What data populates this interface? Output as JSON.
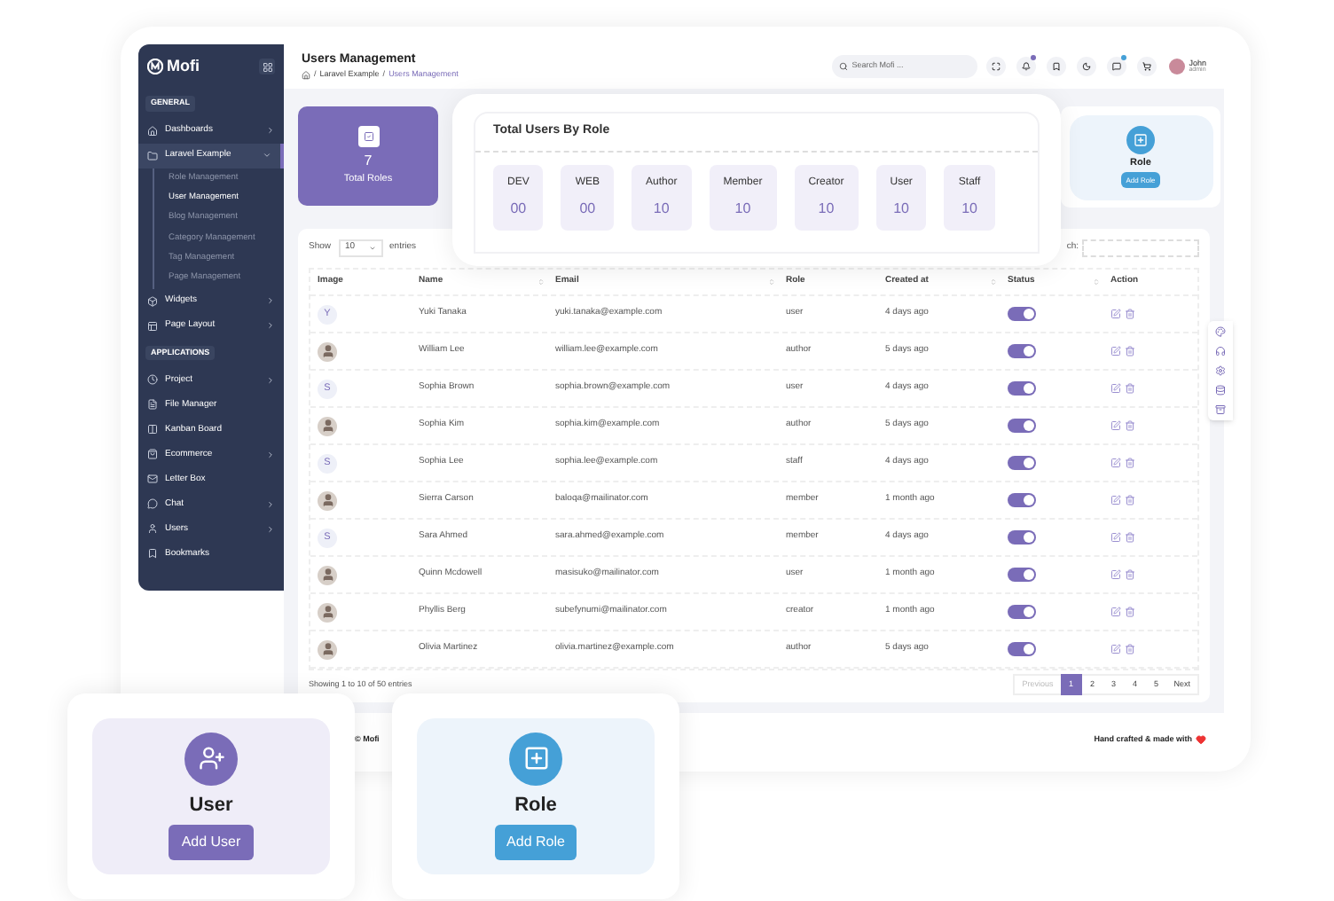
{
  "sidebar": {
    "logo": "Mofi",
    "groups": [
      {
        "label": "GENERAL",
        "items": [
          {
            "label": "Dashboards",
            "expanded": false,
            "selected": false
          },
          {
            "label": "Laravel Example",
            "expanded": true,
            "selected": true,
            "children": [
              {
                "label": "Role Management",
                "selected": false
              },
              {
                "label": "User Management",
                "selected": true
              },
              {
                "label": "Blog Management",
                "selected": false
              },
              {
                "label": "Category Management",
                "selected": false
              },
              {
                "label": "Tag Management",
                "selected": false
              },
              {
                "label": "Page Management",
                "selected": false
              }
            ]
          },
          {
            "label": "Widgets",
            "expanded": false,
            "selected": false
          },
          {
            "label": "Page Layout",
            "expanded": false,
            "selected": false
          }
        ]
      },
      {
        "label": "APPLICATIONS",
        "items": [
          {
            "label": "Project",
            "expanded": false,
            "selected": false
          },
          {
            "label": "File Manager",
            "selected": false
          },
          {
            "label": "Kanban Board",
            "selected": false
          },
          {
            "label": "Ecommerce",
            "expanded": false,
            "selected": false
          },
          {
            "label": "Letter Box",
            "selected": false
          },
          {
            "label": "Chat",
            "expanded": false,
            "selected": false
          },
          {
            "label": "Users",
            "expanded": false,
            "selected": false
          },
          {
            "label": "Bookmarks",
            "selected": false
          }
        ]
      }
    ]
  },
  "header": {
    "title": "Users Management",
    "breadcrumb": [
      {
        "kind": "separator",
        "text": "/"
      },
      {
        "kind": "link",
        "text": "Laravel Example"
      },
      {
        "kind": "separator",
        "text": "/"
      },
      {
        "kind": "current",
        "text": "Users Management"
      }
    ],
    "search": {
      "placeholder": "Search Mofi ..."
    },
    "user": {
      "name": "John",
      "role": "admin"
    }
  },
  "total_roles": {
    "value": "7",
    "label": "Total Roles"
  },
  "role_card": {
    "title": "Role",
    "button": "Add Role"
  },
  "roles_popup": {
    "title": "Total Users By Role",
    "roles": [
      {
        "name": "DEV",
        "count": "00"
      },
      {
        "name": "WEB",
        "count": "00"
      },
      {
        "name": "Author",
        "count": "10"
      },
      {
        "name": "Member",
        "count": "10"
      },
      {
        "name": "Creator",
        "count": "10"
      },
      {
        "name": "User",
        "count": "10"
      },
      {
        "name": "Staff",
        "count": "10"
      }
    ]
  },
  "table": {
    "show_label": "Show",
    "page_size": "10",
    "entries_label": "entries",
    "search_label": "ch:",
    "columns": [
      {
        "label": "Image",
        "sortable": false
      },
      {
        "label": "Name",
        "sortable": true
      },
      {
        "label": "Email",
        "sortable": true
      },
      {
        "label": "Role",
        "sortable": false
      },
      {
        "label": "Created at",
        "sortable": true
      },
      {
        "label": "Status",
        "sortable": true
      },
      {
        "label": "Action",
        "sortable": false
      }
    ],
    "rows": [
      {
        "avatar": {
          "kind": "letter",
          "letter": "Y"
        },
        "name": "Yuki Tanaka",
        "email": "yuki.tanaka@example.com",
        "role": "user",
        "created": "4 days ago",
        "active": true
      },
      {
        "avatar": {
          "kind": "photo"
        },
        "name": "William Lee",
        "email": "william.lee@example.com",
        "role": "author",
        "created": "5 days ago",
        "active": true
      },
      {
        "avatar": {
          "kind": "letter",
          "letter": "S"
        },
        "name": "Sophia Brown",
        "email": "sophia.brown@example.com",
        "role": "user",
        "created": "4 days ago",
        "active": true
      },
      {
        "avatar": {
          "kind": "photo"
        },
        "name": "Sophia Kim",
        "email": "sophia.kim@example.com",
        "role": "author",
        "created": "5 days ago",
        "active": true
      },
      {
        "avatar": {
          "kind": "letter",
          "letter": "S"
        },
        "name": "Sophia Lee",
        "email": "sophia.lee@example.com",
        "role": "staff",
        "created": "4 days ago",
        "active": true
      },
      {
        "avatar": {
          "kind": "photo"
        },
        "name": "Sierra Carson",
        "email": "baloqa@mailinator.com",
        "role": "member",
        "created": "1 month ago",
        "active": true
      },
      {
        "avatar": {
          "kind": "letter",
          "letter": "S"
        },
        "name": "Sara Ahmed",
        "email": "sara.ahmed@example.com",
        "role": "member",
        "created": "4 days ago",
        "active": true
      },
      {
        "avatar": {
          "kind": "photo"
        },
        "name": "Quinn Mcdowell",
        "email": "masisuko@mailinator.com",
        "role": "user",
        "created": "1 month ago",
        "active": true
      },
      {
        "avatar": {
          "kind": "photo"
        },
        "name": "Phyllis Berg",
        "email": "subefynumi@mailinator.com",
        "role": "creator",
        "created": "1 month ago",
        "active": true
      },
      {
        "avatar": {
          "kind": "photo"
        },
        "name": "Olivia Martinez",
        "email": "olivia.martinez@example.com",
        "role": "author",
        "created": "5 days ago",
        "active": true
      }
    ],
    "info": "Showing 1 to 10 of 50 entries",
    "pagination": {
      "previous": {
        "label": "Previous",
        "disabled": true
      },
      "pages": [
        {
          "label": "1",
          "selected": true
        },
        {
          "label": "2",
          "selected": false
        },
        {
          "label": "3",
          "selected": false
        },
        {
          "label": "4",
          "selected": false
        },
        {
          "label": "5",
          "selected": false
        }
      ],
      "next": {
        "label": "Next",
        "disabled": false
      }
    }
  },
  "footer": {
    "left": "© Mofi",
    "right": "Hand crafted & made with"
  },
  "promo_cards": [
    {
      "kind": "user",
      "title": "User",
      "button": "Add User"
    },
    {
      "kind": "role",
      "title": "Role",
      "button": "Add Role"
    }
  ]
}
